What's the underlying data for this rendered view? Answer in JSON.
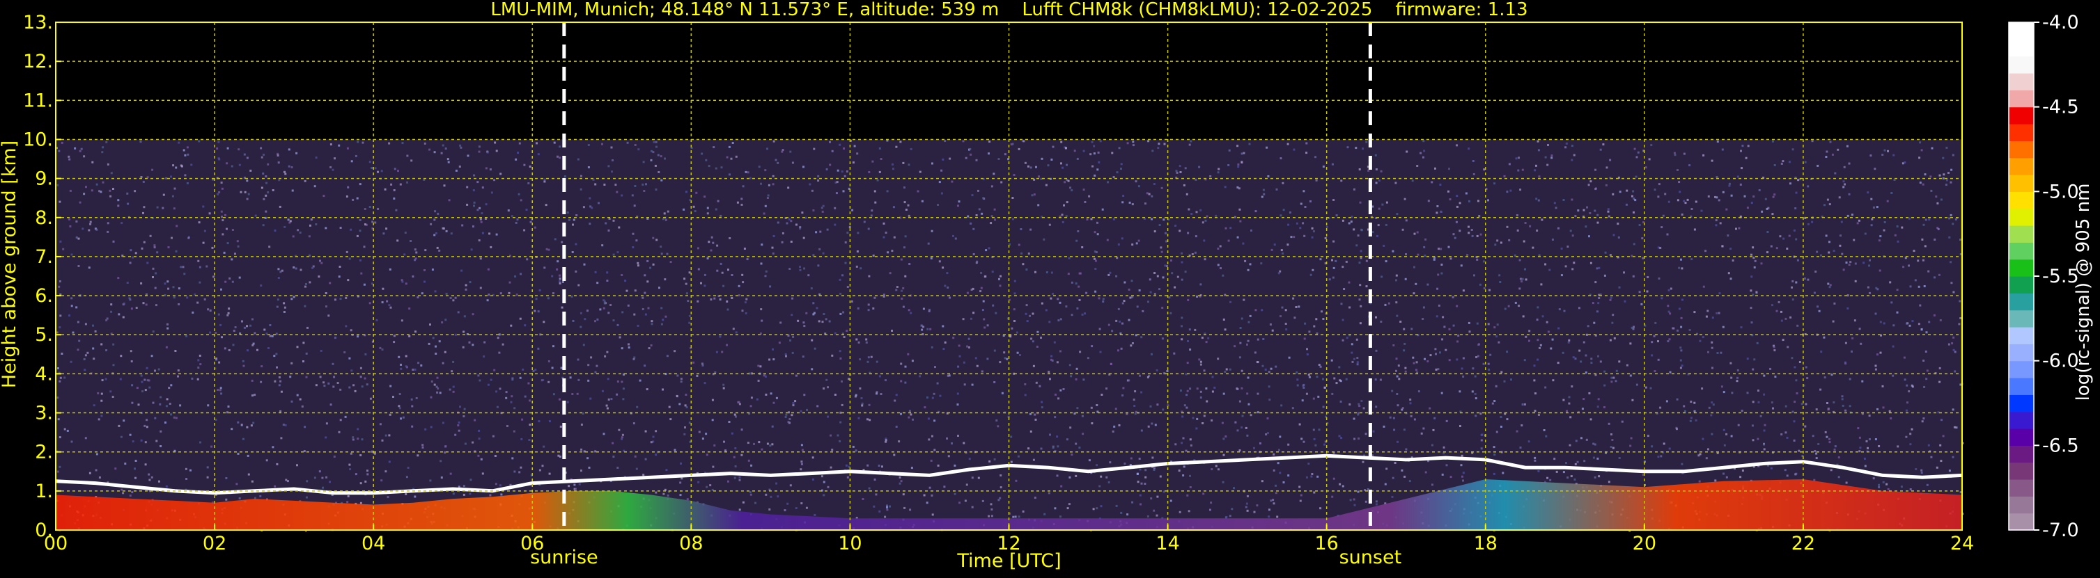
{
  "colors": {
    "background": "#000000",
    "text": "#ffff00",
    "grid": "#c8c800",
    "colorbar_text": "#ffffff",
    "sun_lines": "#ffffff"
  },
  "chart_data": {
    "type": "heatmap",
    "title": "LMU-MIM, Munich; 48.148° N 11.573° E, altitude: 539 m    Lufft CHM8k (CHM8kLMU): 12-02-2025    firmware: 1.13",
    "xlabel": "Time [UTC]",
    "ylabel": "Height above ground [km]",
    "xlim": [
      0,
      24
    ],
    "ylim": [
      0,
      13
    ],
    "x_ticks": [
      0,
      2,
      4,
      6,
      8,
      10,
      12,
      14,
      16,
      18,
      20,
      22,
      24
    ],
    "x_tick_labels": [
      "00",
      "02",
      "04",
      "06",
      "08",
      "10",
      "12",
      "14",
      "16",
      "18",
      "20",
      "22",
      "24"
    ],
    "y_ticks": [
      0,
      1,
      2,
      3,
      4,
      5,
      6,
      7,
      8,
      9,
      10,
      11,
      12,
      13
    ],
    "y_tick_labels": [
      "0.",
      "1.",
      "2.",
      "3.",
      "4.",
      "5.",
      "6.",
      "7.",
      "8.",
      "9.",
      "10.",
      "11.",
      "12.",
      "13."
    ],
    "grid": true,
    "data_top_km": 10,
    "sunrise": {
      "time": 6.4,
      "label": "sunrise"
    },
    "sunset": {
      "time": 16.55,
      "label": "sunset"
    },
    "colorbar": {
      "label": "log(rc-signal) @ 905 nm",
      "range": [
        -7.0,
        -4.0
      ],
      "ticks": [
        -7.0,
        -6.5,
        -6.0,
        -5.5,
        -5.0,
        -4.5,
        -4.0
      ],
      "tick_labels": [
        "-7.0",
        "-6.5",
        "-6.0",
        "-5.5",
        "-5.0",
        "-4.5",
        "-4.0"
      ],
      "colors": [
        "#a890a8",
        "#987898",
        "#885888",
        "#783878",
        "#6a1a82",
        "#5a00a8",
        "#3a1ad0",
        "#0038ff",
        "#4a78ff",
        "#7898ff",
        "#98b0ff",
        "#b0c8ff",
        "#6ab8b8",
        "#28a0a0",
        "#10a050",
        "#18c018",
        "#60d060",
        "#a0e050",
        "#e0f000",
        "#ffe000",
        "#ffc000",
        "#ffa000",
        "#ff7000",
        "#ff3000",
        "#f00000",
        "#f0a8a8",
        "#f0d0d0",
        "#f8f8f8",
        "#ffffff",
        "#ffffff"
      ]
    },
    "layers": {
      "cloud_top_line_km": [
        [
          0.0,
          1.25
        ],
        [
          0.5,
          1.2
        ],
        [
          1.0,
          1.1
        ],
        [
          1.5,
          1.0
        ],
        [
          2.0,
          0.95
        ],
        [
          2.5,
          1.0
        ],
        [
          3.0,
          1.05
        ],
        [
          3.5,
          0.95
        ],
        [
          4.0,
          0.95
        ],
        [
          4.5,
          1.0
        ],
        [
          5.0,
          1.05
        ],
        [
          5.5,
          1.0
        ],
        [
          6.0,
          1.2
        ],
        [
          6.5,
          1.25
        ],
        [
          7.0,
          1.3
        ],
        [
          7.5,
          1.35
        ],
        [
          8.0,
          1.4
        ],
        [
          8.5,
          1.45
        ],
        [
          9.0,
          1.4
        ],
        [
          9.5,
          1.45
        ],
        [
          10.0,
          1.5
        ],
        [
          10.5,
          1.45
        ],
        [
          11.0,
          1.4
        ],
        [
          11.5,
          1.55
        ],
        [
          12.0,
          1.65
        ],
        [
          12.5,
          1.6
        ],
        [
          13.0,
          1.5
        ],
        [
          13.5,
          1.6
        ],
        [
          14.0,
          1.7
        ],
        [
          14.5,
          1.75
        ],
        [
          15.0,
          1.8
        ],
        [
          15.5,
          1.85
        ],
        [
          16.0,
          1.9
        ],
        [
          16.5,
          1.85
        ],
        [
          17.0,
          1.8
        ],
        [
          17.5,
          1.85
        ],
        [
          18.0,
          1.8
        ],
        [
          18.5,
          1.6
        ],
        [
          19.0,
          1.6
        ],
        [
          19.5,
          1.55
        ],
        [
          20.0,
          1.5
        ],
        [
          20.5,
          1.5
        ],
        [
          21.0,
          1.6
        ],
        [
          21.5,
          1.7
        ],
        [
          22.0,
          1.75
        ],
        [
          22.5,
          1.6
        ],
        [
          23.0,
          1.4
        ],
        [
          23.5,
          1.35
        ],
        [
          24.0,
          1.4
        ]
      ],
      "boundary_layer_top_km": [
        [
          0.0,
          0.9
        ],
        [
          0.5,
          0.85
        ],
        [
          1.0,
          0.8
        ],
        [
          1.5,
          0.75
        ],
        [
          2.0,
          0.7
        ],
        [
          2.5,
          0.8
        ],
        [
          3.0,
          0.75
        ],
        [
          3.5,
          0.7
        ],
        [
          4.0,
          0.65
        ],
        [
          4.5,
          0.7
        ],
        [
          5.0,
          0.8
        ],
        [
          5.5,
          0.85
        ],
        [
          6.0,
          0.95
        ],
        [
          6.5,
          1.0
        ],
        [
          7.0,
          1.0
        ],
        [
          7.5,
          0.9
        ],
        [
          8.0,
          0.75
        ],
        [
          8.5,
          0.5
        ],
        [
          9.0,
          0.4
        ],
        [
          9.5,
          0.35
        ],
        [
          10.0,
          0.3
        ],
        [
          12.0,
          0.3
        ],
        [
          14.0,
          0.3
        ],
        [
          16.0,
          0.3
        ],
        [
          17.0,
          0.8
        ],
        [
          18.0,
          1.3
        ],
        [
          19.0,
          1.2
        ],
        [
          20.0,
          1.1
        ],
        [
          21.0,
          1.25
        ],
        [
          22.0,
          1.3
        ],
        [
          23.0,
          1.0
        ],
        [
          24.0,
          0.9
        ]
      ]
    }
  }
}
